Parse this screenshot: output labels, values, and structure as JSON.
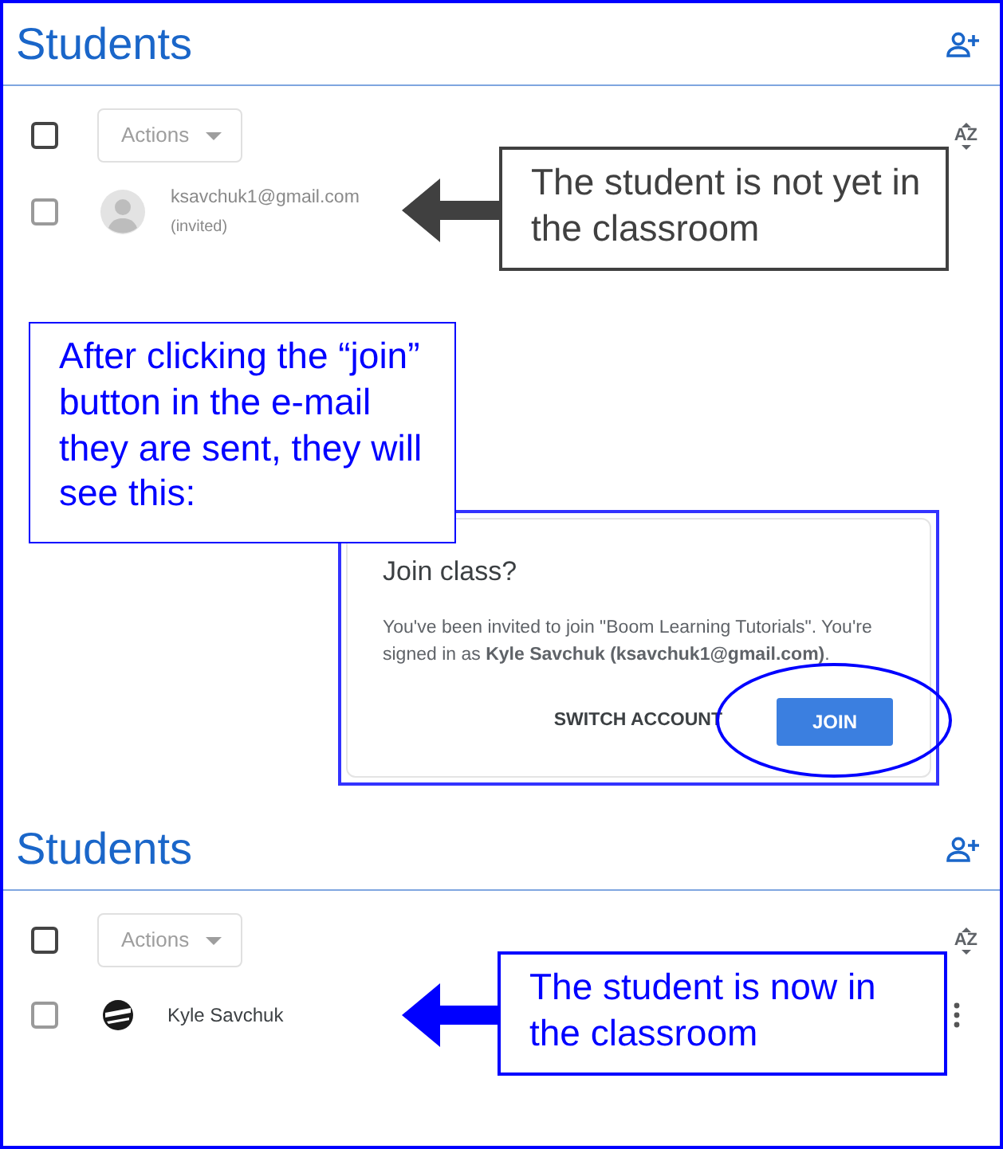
{
  "panels": [
    {
      "title": "Students",
      "select_all": {
        "checked": false
      },
      "actions_label": "Actions",
      "sort_label": "AZ",
      "students": [
        {
          "kind": "invited",
          "name": "ksavchuk1@gmail.com",
          "note": "(invited)",
          "checked": false
        }
      ],
      "callout": {
        "text": "The student is not yet in the classroom",
        "color": "#404040"
      }
    },
    {
      "title": "Students",
      "select_all": {
        "checked": false
      },
      "actions_label": "Actions",
      "sort_label": "AZ",
      "students": [
        {
          "kind": "joined",
          "name": "Kyle Savchuk",
          "checked": false
        }
      ],
      "callout": {
        "text": "The student is now in the classroom",
        "color": "#0000ff"
      }
    }
  ],
  "instruction": "After clicking the “join” button in the e-mail they are sent, they will see this:",
  "dialog": {
    "title": "Join class?",
    "message": "You've been invited to join \"Boom Learning Tutorials\". You're signed in as **Kyle Savchuk (ksavchuk1@gmail.com)**.",
    "buttons": [
      {
        "label": "SWITCH ACCOUNT",
        "kind": "text",
        "highlighted": false
      },
      {
        "label": "JOIN",
        "kind": "primary",
        "highlighted": true
      }
    ]
  }
}
